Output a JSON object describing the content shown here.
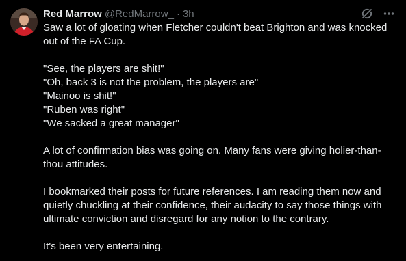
{
  "author": {
    "display_name": "Red Marrow",
    "handle": "@RedMarrow_",
    "separator": "·",
    "time": "3h"
  },
  "icons": {
    "grok": "grok-icon",
    "more": "more-options-icon"
  },
  "colors": {
    "background": "#000000",
    "text_primary": "#e7e9ea",
    "text_secondary": "#71767b"
  },
  "tweet": {
    "paragraphs": [
      [
        "Saw a lot of gloating when Fletcher couldn't beat Brighton and was knocked",
        "out of the FA Cup."
      ],
      [
        "\"See, the players are shit!\"",
        "\"Oh, back 3 is not the problem, the players are\"",
        "\"Mainoo is shit!\"",
        "\"Ruben was right\"",
        "\"We sacked a great manager\""
      ],
      [
        "A lot of confirmation bias was going on. Many fans were giving holier-than-",
        "thou attitudes."
      ],
      [
        "I bookmarked their posts for future references. I am reading them now and",
        "quietly chuckling at their confidence, their audacity to say those things with",
        "ultimate conviction and disregard for any notion to the contrary."
      ],
      [
        "It's been very entertaining."
      ]
    ]
  }
}
